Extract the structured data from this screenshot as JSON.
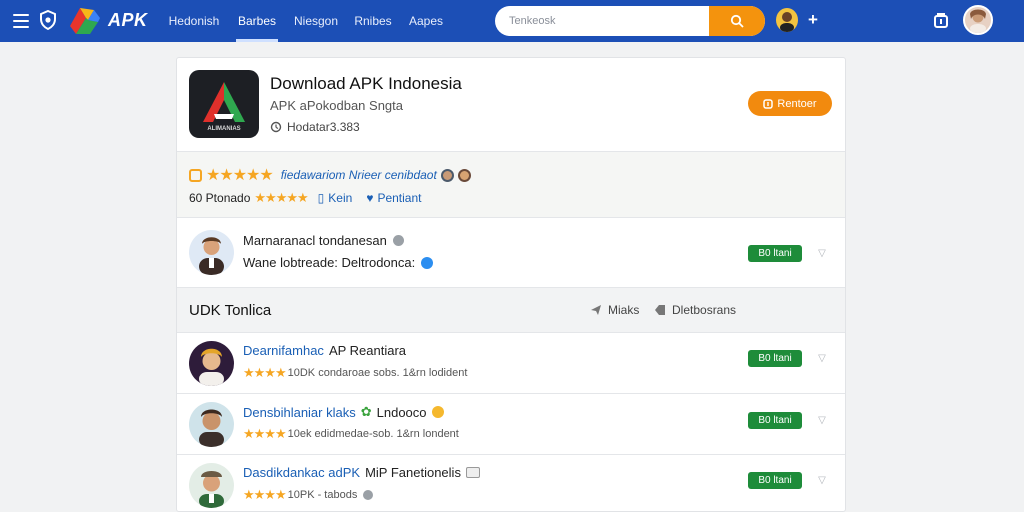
{
  "header": {
    "logo_text": "APK",
    "nav": [
      "Hedonish",
      "Barbes",
      "Niesgon",
      "Rnibes",
      "Aapes"
    ],
    "active_nav_index": 1,
    "search_placeholder": "Tenkeosk",
    "accent_color": "#1c4fb6",
    "search_button_color": "#f4930d",
    "icons": [
      "menu-icon",
      "shield-icon",
      "logo-mark",
      "search-icon",
      "avatar",
      "plus-icon",
      "bag-icon",
      "profile-avatar"
    ]
  },
  "app": {
    "title": "Download APK Indonesia",
    "subtitle": "APK aPokodban Sngta",
    "meta": "Hodatar3.383",
    "icon_label": "ALIMANIAS",
    "download_label": "Rentoer"
  },
  "rating": {
    "stars": 5,
    "headline": "fiedawariom Nrieer cenibdaot",
    "count": "60 Ptonado",
    "link1": "Kein",
    "link2": "Pentiant"
  },
  "developer": {
    "name_line": "Marnaranacl tondanesan",
    "info_line": "Wane lobtreade: Deltrodonca:",
    "button_label": "B0 ltani"
  },
  "list": {
    "title": "UDK Tonlica",
    "action1": "Miaks",
    "action2": "Dletbosrans",
    "items": [
      {
        "title": "Dearnifamhac",
        "title_suffix": "AP Reantiara",
        "rating": 4,
        "meta": "10DK condaroae sobs.  1&rn  lodident",
        "button_label": "B0 ltani"
      },
      {
        "title": "Densbihlaniar klaks",
        "title_suffix": "Lndooco",
        "rating": 4,
        "meta": "10ek edidmedae-sob.  1&rn  londent",
        "button_label": "B0 ltani"
      },
      {
        "title": "Dasdikdankac adPK",
        "title_suffix": "MiP Fanetionelis",
        "rating": 4,
        "meta": "10PK - tabods",
        "button_label": "B0 ltani"
      }
    ]
  }
}
